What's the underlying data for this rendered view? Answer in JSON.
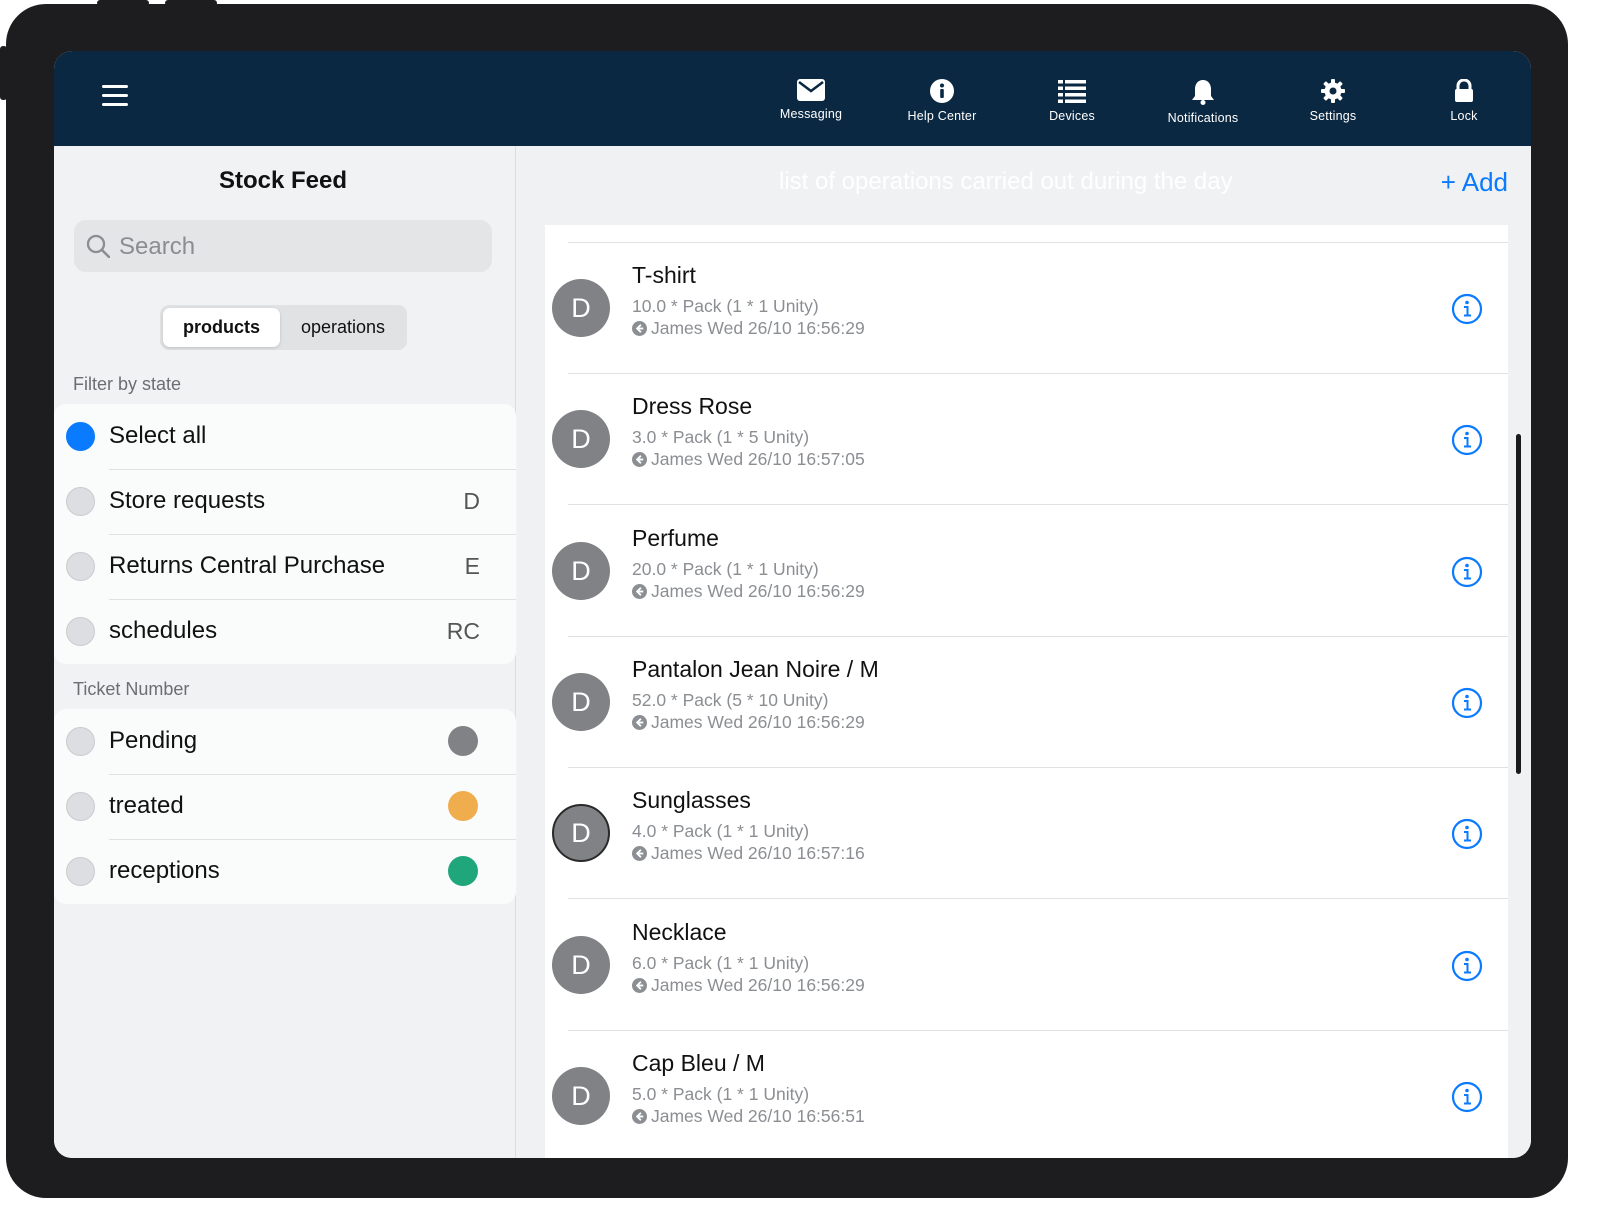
{
  "nav": {
    "items": [
      {
        "label": "Messaging",
        "icon": "envelope-icon"
      },
      {
        "label": "Help Center",
        "icon": "info-circle-icon"
      },
      {
        "label": "Devices",
        "icon": "list-icon"
      },
      {
        "label": "Notifications",
        "icon": "bell-icon"
      },
      {
        "label": "Settings",
        "icon": "gear-icon"
      },
      {
        "label": "Lock",
        "icon": "lock-icon"
      }
    ]
  },
  "sidebar": {
    "title": "Stock Feed",
    "search_placeholder": "Search",
    "segments": {
      "active": "products",
      "other": "operations"
    },
    "filter_heading": "Filter by state",
    "filters": [
      {
        "label": "Select all",
        "code": "",
        "selected": true
      },
      {
        "label": "Store requests",
        "code": "D",
        "selected": false
      },
      {
        "label": "Returns Central Purchase",
        "code": "E",
        "selected": false
      },
      {
        "label": "schedules",
        "code": "RC",
        "selected": false
      }
    ],
    "ticket_heading": "Ticket Number",
    "tickets": [
      {
        "label": "Pending",
        "color": "#808285"
      },
      {
        "label": "treated",
        "color": "#f0ad4e"
      },
      {
        "label": "receptions",
        "color": "#1fa67a"
      }
    ]
  },
  "main": {
    "title": "list of operations carried out during the day",
    "add_label": "+ Add",
    "items": [
      {
        "avatar": "D",
        "title": "T-shirt",
        "sub": "10.0 * Pack (1 * 1 Unity)",
        "meta": "James Wed 26/10 16:56:29"
      },
      {
        "avatar": "D",
        "title": "Dress Rose",
        "sub": "3.0 * Pack (1 * 5 Unity)",
        "meta": "James Wed 26/10 16:57:05"
      },
      {
        "avatar": "D",
        "title": "Perfume",
        "sub": "20.0 * Pack (1 * 1 Unity)",
        "meta": "James Wed 26/10 16:56:29"
      },
      {
        "avatar": "D",
        "title": "Pantalon Jean Noire / M",
        "sub": "52.0 * Pack (5 * 10 Unity)",
        "meta": "James Wed 26/10 16:56:29"
      },
      {
        "avatar": "D",
        "title": "Sunglasses",
        "sub": "4.0 * Pack (1 * 1 Unity)",
        "meta": "James Wed 26/10 16:57:16"
      },
      {
        "avatar": "D",
        "title": "Necklace",
        "sub": "6.0 * Pack (1 * 1 Unity)",
        "meta": "James Wed 26/10 16:56:29"
      },
      {
        "avatar": "D",
        "title": "Cap Bleu / M",
        "sub": "5.0 * Pack (1 * 1 Unity)",
        "meta": "James Wed 26/10 16:56:51"
      }
    ]
  }
}
